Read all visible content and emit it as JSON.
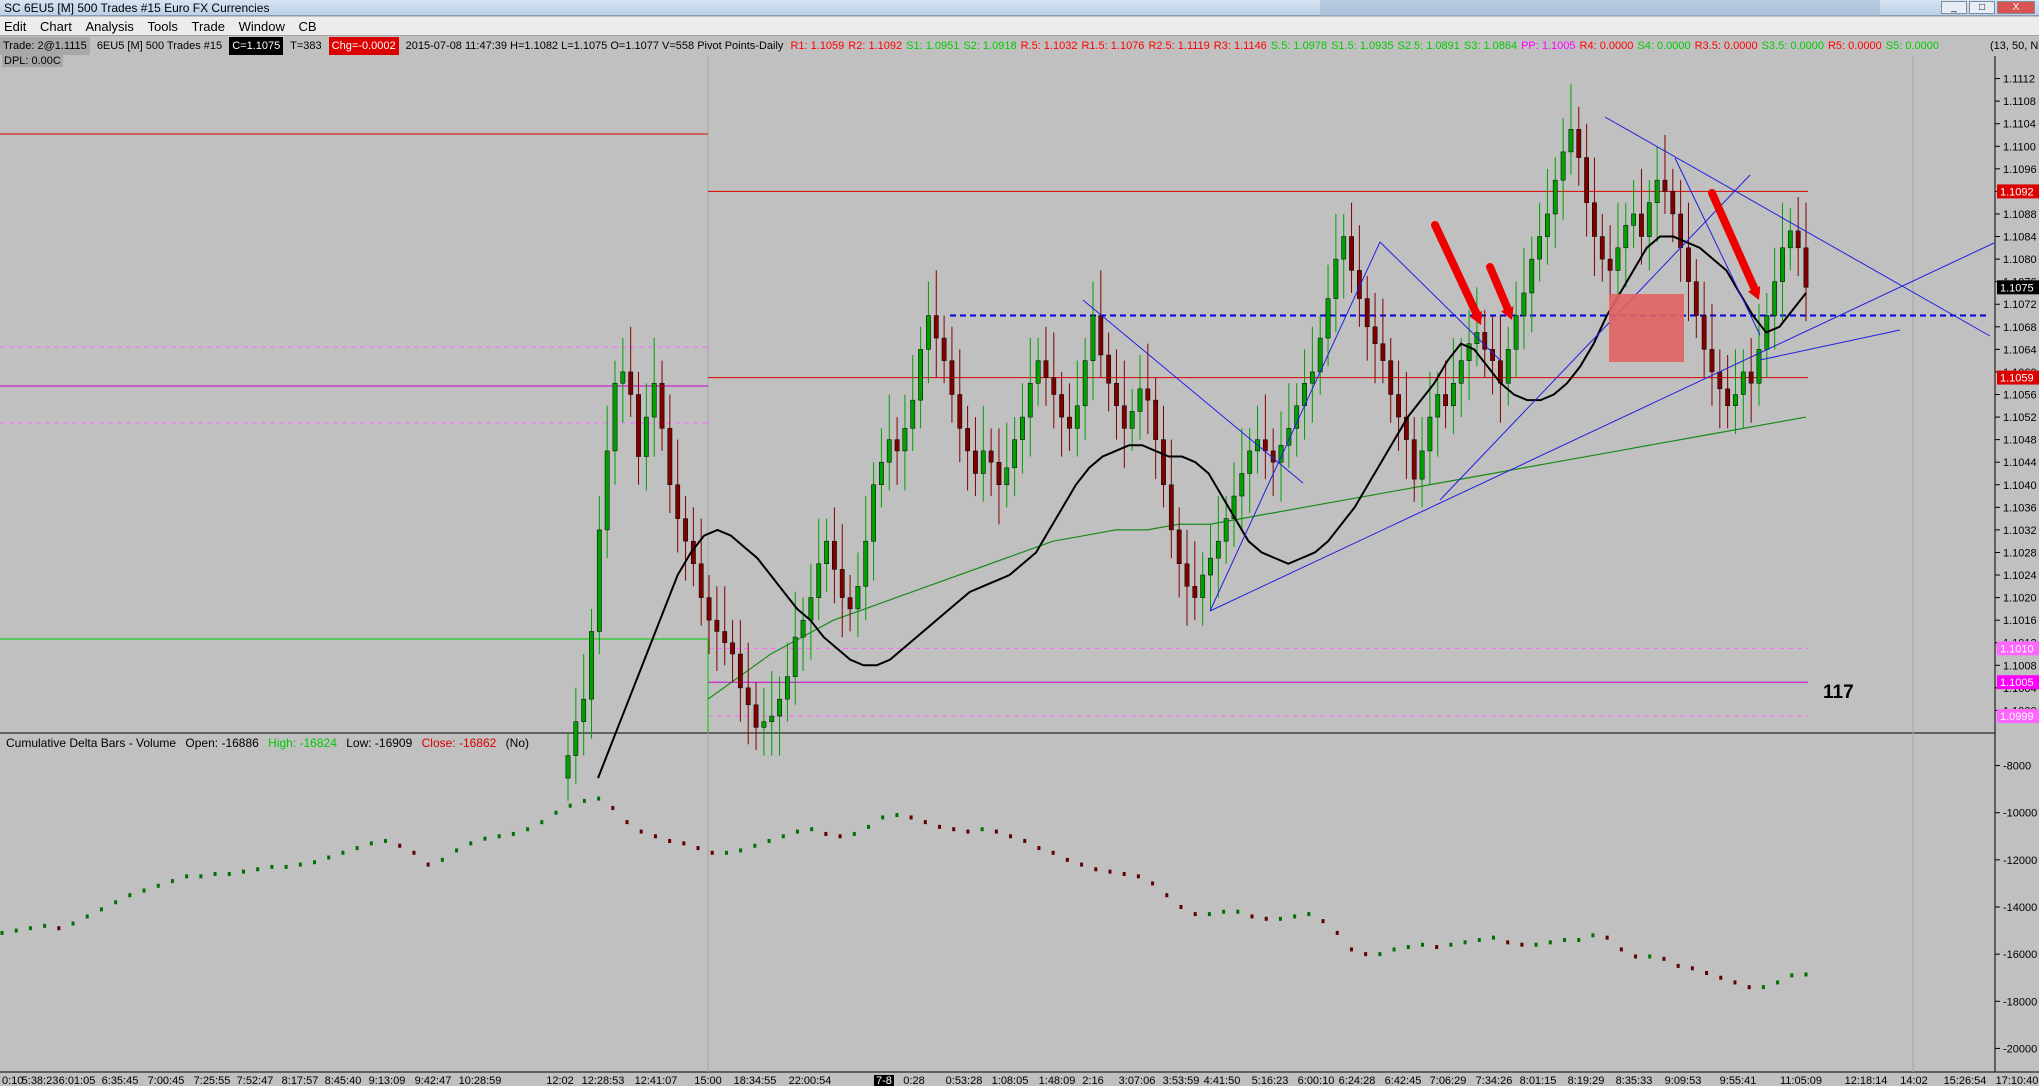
{
  "window": {
    "title": "SC 6EU5 [M]  500 Trades  #15  Euro FX Currencies",
    "controls": [
      "_",
      "□",
      "X"
    ]
  },
  "menu": [
    "Edit",
    "Chart",
    "Analysis",
    "Tools",
    "Trade",
    "Window",
    "CB"
  ],
  "infobar": {
    "trade": "Trade: 2@1.1115",
    "symbol": "6EU5 [M]  500 Trades  #15",
    "close": "C=1.1075",
    "ticks": "T=383",
    "change": "Chg=-0.0002",
    "stats": "2015-07-08 11:47:39 H=1.1082 L=1.1075 O=1.1077 V=558 Pivot Points-Daily",
    "pivots": [
      {
        "text": "R1: 1.1059",
        "color": "#ff0000"
      },
      {
        "text": "R2: 1.1092",
        "color": "#ff0000"
      },
      {
        "text": "S1: 1.0951",
        "color": "#00cc00"
      },
      {
        "text": "S2: 1.0918",
        "color": "#00cc00"
      },
      {
        "text": "R.5: 1.1032",
        "color": "#ff0000"
      },
      {
        "text": "R1.5: 1.1076",
        "color": "#ff0000"
      },
      {
        "text": "R2.5: 1.1119",
        "color": "#ff0000"
      },
      {
        "text": "R3: 1.1146",
        "color": "#ff0000"
      },
      {
        "text": "S.5: 1.0978",
        "color": "#00cc00"
      },
      {
        "text": "S1.5: 1.0935",
        "color": "#00cc00"
      },
      {
        "text": "S2.5: 1.0891",
        "color": "#00cc00"
      },
      {
        "text": "S3: 1.0864",
        "color": "#00cc00"
      },
      {
        "text": "PP: 1.1005",
        "color": "#ff00ff"
      },
      {
        "text": "R4: 0.0000",
        "color": "#ff0000"
      },
      {
        "text": "S4: 0.0000",
        "color": "#00cc00"
      },
      {
        "text": "R3.5: 0.0000",
        "color": "#ff0000"
      },
      {
        "text": "S3.5: 0.0000",
        "color": "#00cc00"
      },
      {
        "text": "R5: 0.0000",
        "color": "#ff0000"
      },
      {
        "text": "S5: 0.0000",
        "color": "#00cc00"
      }
    ],
    "tail": "(13, 50, N"
  },
  "dpl": "DPL: 0.00C",
  "counter": "117",
  "subchart": {
    "title": "Cumulative Delta Bars - Volume",
    "open": "Open: -16886",
    "high": "High: -16824",
    "low": "Low: -16909",
    "close": "Close: -16862",
    "flag": "(No)"
  },
  "colors": {
    "background": "#c0c0c0",
    "bull": "#00a000",
    "bear": "#800000",
    "resistance": "#dd0000",
    "pivot": "#ff00ff",
    "support": "#00cc00",
    "trendline": "#2020e0",
    "arrow": "#ee0000",
    "zone": "#e36262"
  },
  "chart_data": [
    {
      "type": "candlestick",
      "title": "6EU5 [M] 500 Trades #15",
      "ylim": [
        1.0996,
        1.1116
      ],
      "yticks": [
        "1.1112",
        "1.1108",
        "1.1104",
        "1.1100",
        "1.1096",
        "1.1092",
        "1.1088",
        "1.1084",
        "1.1080",
        "1.1076",
        "1.1072",
        "1.1068",
        "1.1064",
        "1.1060",
        "1.1056",
        "1.1052",
        "1.1048",
        "1.1044",
        "1.1040",
        "1.1036",
        "1.1032",
        "1.1028",
        "1.1024",
        "1.1020",
        "1.1016",
        "1.1012",
        "1.1008",
        "1.1004",
        "1.1000"
      ],
      "price_tags": [
        {
          "label": "1.1092",
          "value": 1.1092,
          "bg": "#dd0000",
          "fg": "#ffffff"
        },
        {
          "label": "1.1075",
          "value": 1.1075,
          "bg": "#000000",
          "fg": "#ffffff"
        },
        {
          "label": "1.1059",
          "value": 1.1059,
          "bg": "#dd0000",
          "fg": "#ffffff"
        },
        {
          "label": "1.1010",
          "value": 1.1011,
          "bg": "#ff66ff",
          "fg": "#ffffff"
        },
        {
          "label": "1.1005",
          "value": 1.1005,
          "bg": "#ff00ff",
          "fg": "#ffffff"
        },
        {
          "label": "1.0999",
          "value": 1.0999,
          "bg": "#ff66ff",
          "fg": "#ffffff"
        }
      ],
      "xticks": [
        "0:10",
        "5:38:23",
        "6:01:05",
        "6:35:45",
        "7:00:45",
        "7:25:55",
        "7:52:47",
        "8:17:57",
        "8:45:40",
        "9:13:09",
        "9:42:47",
        "10:28:59",
        "12:02",
        "12:28:53",
        "12:41:07",
        "15:00",
        "18:34:55",
        "22:00:54",
        "7-8",
        "0:28",
        "0:53:28",
        "1:08:05",
        "1:48:09",
        "2:16",
        "3:07:06",
        "3:53:59",
        "4:41:50",
        "5:16:23",
        "6:00:10",
        "6:24:28",
        "6:42:45",
        "7:06:29",
        "7:34:26",
        "8:01:15",
        "8:19:29",
        "8:35:33",
        "9:09:53",
        "9:55:41",
        "11:05:09",
        "12:18:14",
        "14:02",
        "15:26:54",
        "17:10:40"
      ],
      "closes": [
        1.0992,
        1.0998,
        1.1002,
        1.1014,
        1.1032,
        1.1046,
        1.1058,
        1.106,
        1.1056,
        1.1045,
        1.1052,
        1.1058,
        1.105,
        1.104,
        1.1034,
        1.103,
        1.1026,
        1.102,
        1.1016,
        1.1014,
        1.1012,
        1.101,
        1.1004,
        1.1001,
        1.0997,
        1.0998,
        1.0999,
        1.1002,
        1.1006,
        1.1013,
        1.1016,
        1.102,
        1.1026,
        1.103,
        1.1025,
        1.102,
        1.1018,
        1.1022,
        1.103,
        1.104,
        1.1044,
        1.1048,
        1.1046,
        1.105,
        1.1055,
        1.1064,
        1.107,
        1.1066,
        1.1062,
        1.1056,
        1.105,
        1.1046,
        1.1042,
        1.1046,
        1.1044,
        1.104,
        1.1043,
        1.1048,
        1.1052,
        1.1058,
        1.1062,
        1.1059,
        1.1056,
        1.1052,
        1.105,
        1.1054,
        1.1062,
        1.107,
        1.1063,
        1.1058,
        1.1054,
        1.105,
        1.1053,
        1.1057,
        1.1055,
        1.1048,
        1.104,
        1.1032,
        1.1026,
        1.1022,
        1.102,
        1.1024,
        1.1027,
        1.103,
        1.1034,
        1.1038,
        1.1042,
        1.1046,
        1.1048,
        1.1046,
        1.1044,
        1.1047,
        1.105,
        1.1054,
        1.1058,
        1.106,
        1.1066,
        1.1073,
        1.108,
        1.1084,
        1.1078,
        1.1073,
        1.1068,
        1.1065,
        1.1062,
        1.1056,
        1.1052,
        1.1048,
        1.1041,
        1.1046,
        1.1052,
        1.1056,
        1.1054,
        1.1058,
        1.1062,
        1.1065,
        1.1067,
        1.1064,
        1.1062,
        1.1058,
        1.1064,
        1.107,
        1.1074,
        1.108,
        1.1084,
        1.1088,
        1.1094,
        1.1099,
        1.1103,
        1.1098,
        1.109,
        1.1084,
        1.108,
        1.1078,
        1.1082,
        1.1086,
        1.1088,
        1.1084,
        1.109,
        1.1094,
        1.1092,
        1.1088,
        1.1082,
        1.1076,
        1.107,
        1.1064,
        1.106,
        1.1057,
        1.1054,
        1.1056,
        1.106,
        1.1058,
        1.1064,
        1.107,
        1.1076,
        1.1082,
        1.1085,
        1.1082,
        1.1075
      ],
      "sma_black": [
        1.0988,
        1.0994,
        1.1,
        1.1006,
        1.1012,
        1.1018,
        1.1024,
        1.1028,
        1.1031,
        1.1032,
        1.1031,
        1.1029,
        1.1027,
        1.1024,
        1.1021,
        1.1018,
        1.1016,
        1.1013,
        1.1011,
        1.1009,
        1.1008,
        1.1008,
        1.1009,
        1.1011,
        1.1013,
        1.1015,
        1.1017,
        1.1019,
        1.1021,
        1.1022,
        1.1023,
        1.1024,
        1.1026,
        1.1028,
        1.1032,
        1.1036,
        1.104,
        1.1043,
        1.1045,
        1.1046,
        1.1047,
        1.1047,
        1.1046,
        1.1045,
        1.1045,
        1.1044,
        1.1042,
        1.1038,
        1.1034,
        1.103,
        1.1028,
        1.1027,
        1.1026,
        1.1027,
        1.1028,
        1.103,
        1.1033,
        1.1036,
        1.104,
        1.1044,
        1.1048,
        1.1052,
        1.1055,
        1.1058,
        1.1062,
        1.1065,
        1.1064,
        1.1061,
        1.1058,
        1.1056,
        1.1055,
        1.1055,
        1.1056,
        1.1058,
        1.1061,
        1.1065,
        1.107,
        1.1074,
        1.1078,
        1.1082,
        1.1084,
        1.1084,
        1.1083,
        1.1082,
        1.108,
        1.1078,
        1.1074,
        1.107,
        1.1067,
        1.1068,
        1.1071,
        1.1074
      ],
      "sma_green": [
        1.1002,
        1.1006,
        1.101,
        1.1013,
        1.1016,
        1.1018,
        1.102,
        1.1022,
        1.1024,
        1.1026,
        1.1028,
        1.103,
        1.1031,
        1.1032,
        1.1032,
        1.1033,
        1.1033,
        1.1034,
        1.1035,
        1.1036,
        1.1037,
        1.1038,
        1.1039,
        1.104,
        1.1041,
        1.1042,
        1.1043,
        1.1044,
        1.1045,
        1.1046,
        1.1047,
        1.1048,
        1.1049,
        1.105,
        1.1051,
        1.1052
      ],
      "horizontal_levels": [
        {
          "value": 1.1092,
          "color": "#dd0000",
          "style": "solid"
        },
        {
          "value": 1.1059,
          "color": "#dd0000",
          "style": "solid"
        },
        {
          "value": 1.107,
          "color": "#0000dd",
          "style": "dashed"
        },
        {
          "value": 1.1005,
          "color": "#cc00cc",
          "style": "solid"
        },
        {
          "value": 1.1011,
          "color": "#ff66ff",
          "style": "dashed"
        },
        {
          "value": 1.0999,
          "color": "#ff66ff",
          "style": "dashed"
        }
      ]
    },
    {
      "type": "bar",
      "title": "Cumulative Delta Bars - Volume",
      "ylim": [
        -21000,
        -7000
      ],
      "yticks": [
        "-8000",
        "-10000",
        "-12000",
        "-14000",
        "-16000",
        "-18000",
        "-20000"
      ],
      "values": [
        -15100,
        -15000,
        -14900,
        -14800,
        -14900,
        -14700,
        -14400,
        -14100,
        -13800,
        -13500,
        -13300,
        -13100,
        -12900,
        -12700,
        -12700,
        -12600,
        -12600,
        -12500,
        -12400,
        -12300,
        -12300,
        -12200,
        -12100,
        -11900,
        -11700,
        -11500,
        -11300,
        -11200,
        -11400,
        -11700,
        -12200,
        -12000,
        -11600,
        -11300,
        -11100,
        -11000,
        -10900,
        -10700,
        -10400,
        -10000,
        -9700,
        -9500,
        -9400,
        -9800,
        -10400,
        -10800,
        -11000,
        -11200,
        -11300,
        -11500,
        -11700,
        -11700,
        -11600,
        -11400,
        -11200,
        -11000,
        -10800,
        -10700,
        -10900,
        -11000,
        -10900,
        -10600,
        -10200,
        -10100,
        -10200,
        -10400,
        -10600,
        -10700,
        -10800,
        -10700,
        -10800,
        -11000,
        -11200,
        -11500,
        -11700,
        -12000,
        -12200,
        -12400,
        -12500,
        -12600,
        -12700,
        -13000,
        -13500,
        -14000,
        -14300,
        -14300,
        -14200,
        -14200,
        -14400,
        -14500,
        -14500,
        -14400,
        -14300,
        -14600,
        -15100,
        -15800,
        -16000,
        -16000,
        -15800,
        -15700,
        -15600,
        -15700,
        -15600,
        -15500,
        -15400,
        -15300,
        -15500,
        -15600,
        -15600,
        -15500,
        -15400,
        -15400,
        -15200,
        -15300,
        -15800,
        -16100,
        -16100,
        -16200,
        -16500,
        -16600,
        -16800,
        -17000,
        -17200,
        -17400,
        -17400,
        -17200,
        -16900,
        -16862
      ]
    }
  ]
}
